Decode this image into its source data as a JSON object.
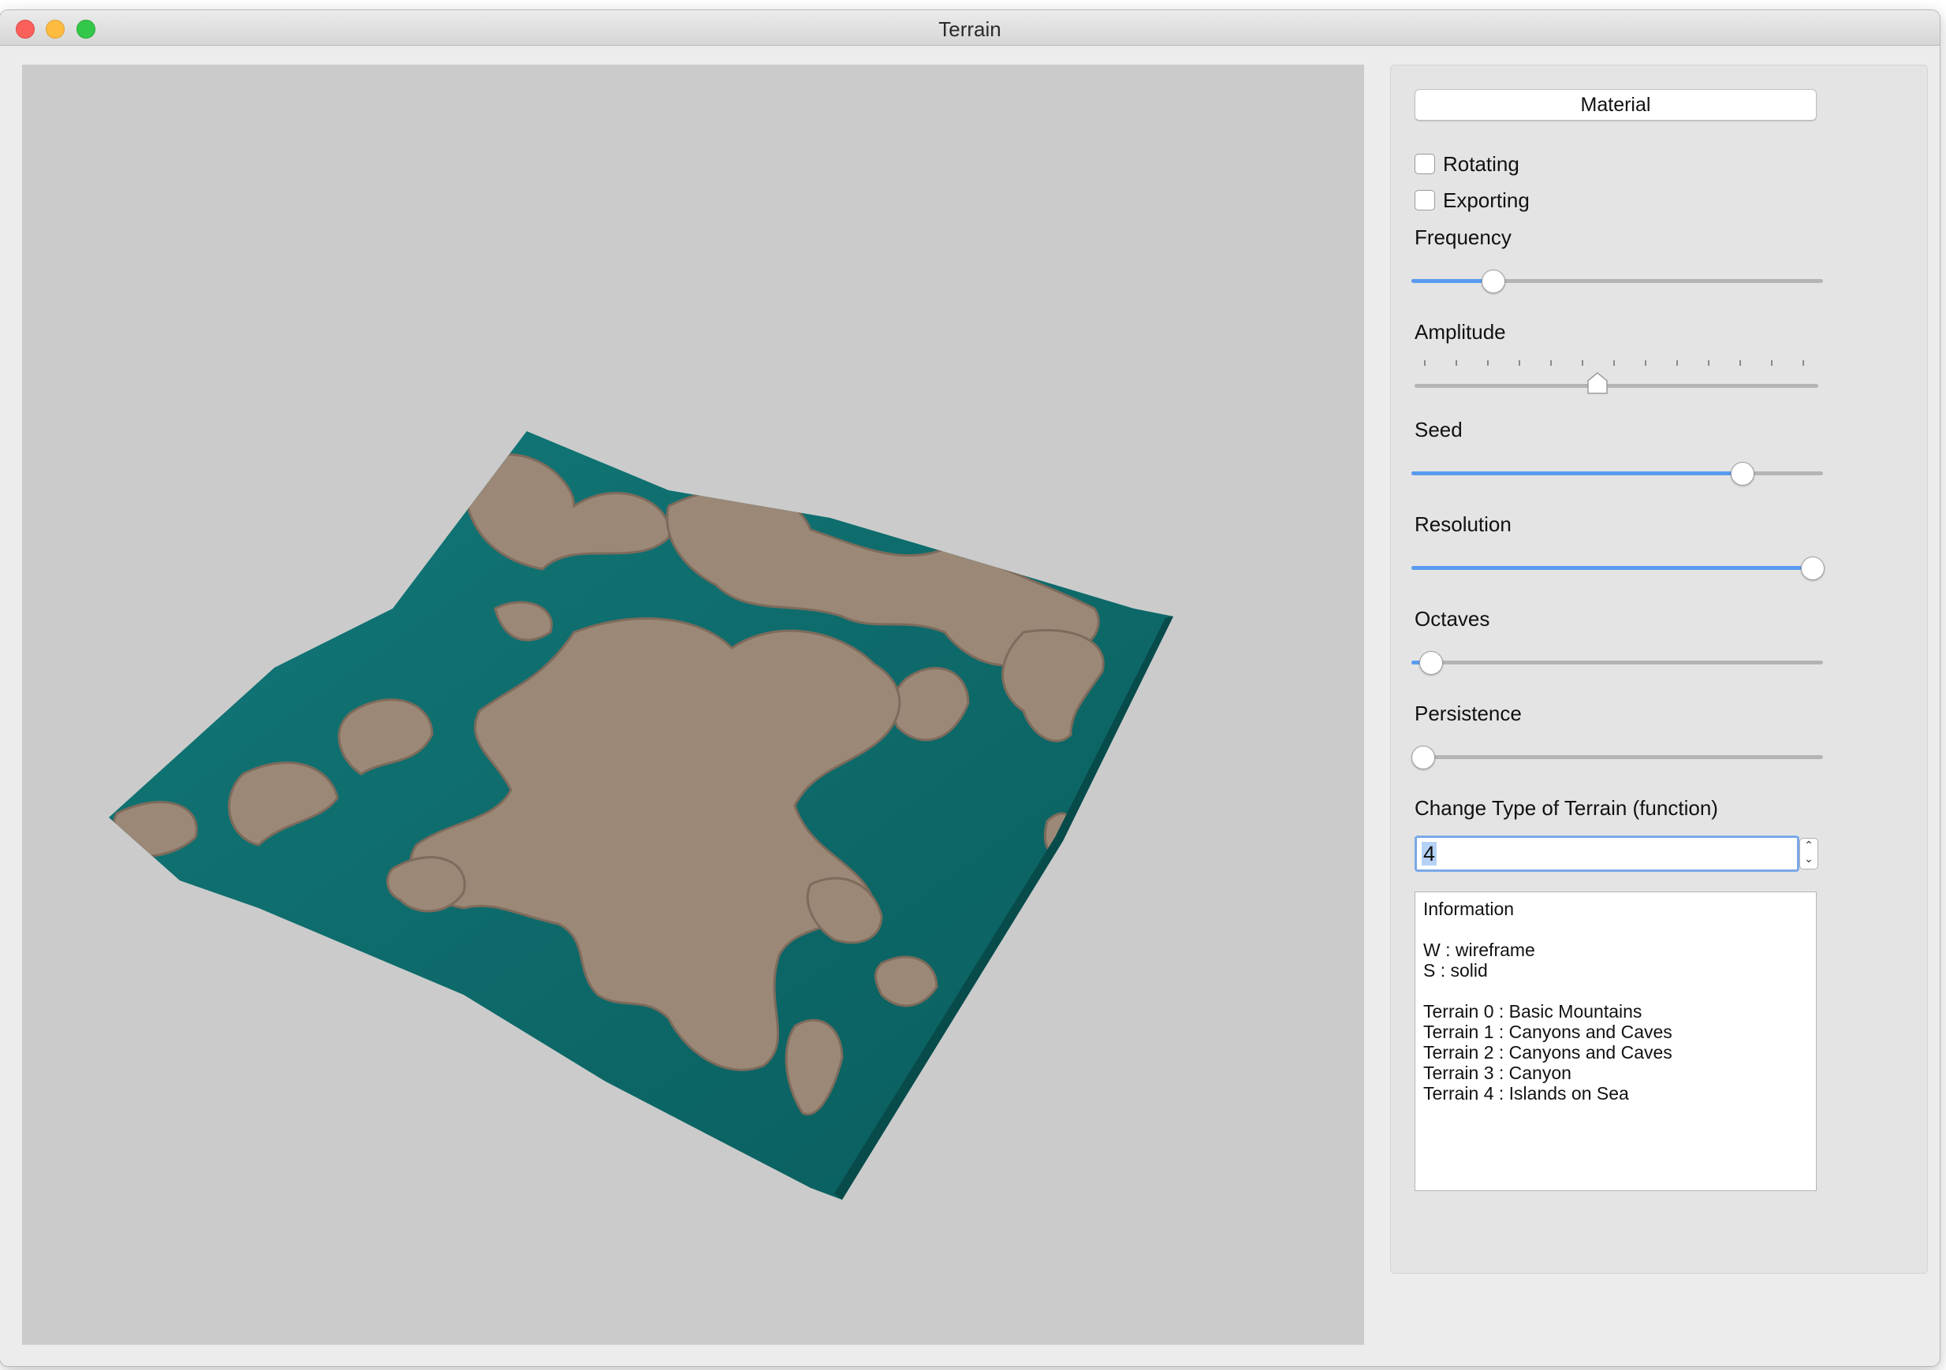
{
  "window": {
    "title": "Terrain"
  },
  "panel": {
    "material_button": "Material",
    "checkboxes": [
      {
        "label": "Rotating",
        "checked": false
      },
      {
        "label": "Exporting",
        "checked": false
      }
    ],
    "sliders": [
      {
        "label": "Frequency",
        "value": 0.2
      },
      {
        "label": "Amplitude",
        "value": 0.45
      },
      {
        "label": "Seed",
        "value": 0.81
      },
      {
        "label": "Resolution",
        "value": 1.0
      },
      {
        "label": "Octaves",
        "value": 0.05
      },
      {
        "label": "Persistence",
        "value": 0.0
      }
    ],
    "terrain_type": {
      "label": "Change Type of Terrain (function)",
      "value": "4"
    },
    "info_lines": [
      "Information",
      "",
      "W : wireframe",
      "S : solid",
      "",
      "Terrain 0 : Basic Mountains",
      "Terrain 1 : Canyons and Caves",
      "Terrain 2 : Canyons and Caves",
      "Terrain 3 : Canyon",
      "Terrain 4 : Islands on Sea"
    ]
  },
  "colors": {
    "water": "#0f6f6f",
    "land": "#9b8877",
    "viewport_bg": "#cbcbcb",
    "slider_fill": "#5a9bf0"
  }
}
